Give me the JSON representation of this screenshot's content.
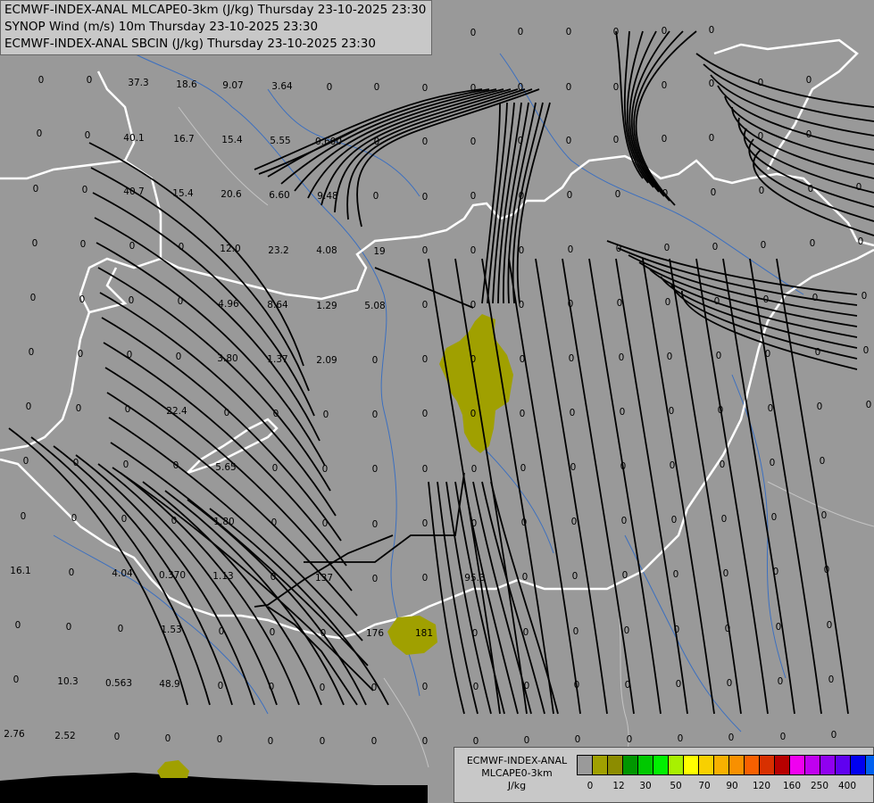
{
  "titles": [
    "ECMWF-INDEX-ANAL MLCAPE0-3km (J/kg) Thursday 23-10-2025 23:30",
    "SYNOP Wind (m/s) 10m Thursday 23-10-2025 23:30",
    "ECMWF-INDEX-ANAL SBCIN (J/kg) Thursday 23-10-2025 23:30"
  ],
  "legend": {
    "title_line1": "ECMWF-INDEX-ANAL",
    "title_line2": "MLCAPE0-3km",
    "unit": "J/kg",
    "colors": [
      "#9a9a9a",
      "#a0a000",
      "#8c8c00",
      "#009600",
      "#00c800",
      "#00f000",
      "#a8f000",
      "#ffff00",
      "#f8d000",
      "#f8b000",
      "#f89000",
      "#f86000",
      "#d83000",
      "#b80000",
      "#f000f0",
      "#c000f0",
      "#9000f0",
      "#6000f0",
      "#0000f0",
      "#0060f0",
      "#00a0f8",
      "#00e0f8",
      "#a0f8f8",
      "#ffffff"
    ],
    "ticks": [
      "0",
      "12",
      "30",
      "50",
      "70",
      "90",
      "120",
      "160",
      "250",
      "400"
    ]
  },
  "values": [
    {
      "t": "0",
      "c": [
        46,
        90
      ]
    },
    {
      "t": "0",
      "c": [
        100,
        90
      ]
    },
    {
      "t": "37.3",
      "c": [
        155,
        93
      ]
    },
    {
      "t": "18.6",
      "c": [
        209,
        95
      ]
    },
    {
      "t": "9.07",
      "c": [
        261,
        96
      ]
    },
    {
      "t": "3.64",
      "c": [
        316,
        97
      ]
    },
    {
      "t": "0",
      "c": [
        369,
        98
      ]
    },
    {
      "t": "0",
      "c": [
        422,
        98
      ]
    },
    {
      "t": "0",
      "c": [
        476,
        99
      ]
    },
    {
      "t": "0",
      "c": [
        530,
        99
      ]
    },
    {
      "t": "0",
      "c": [
        583,
        98
      ]
    },
    {
      "t": "0",
      "c": [
        637,
        98
      ]
    },
    {
      "t": "0",
      "c": [
        690,
        98
      ]
    },
    {
      "t": "0",
      "c": [
        744,
        96
      ]
    },
    {
      "t": "0",
      "c": [
        797,
        94
      ]
    },
    {
      "t": "0",
      "c": [
        852,
        93
      ]
    },
    {
      "t": "0",
      "c": [
        906,
        90
      ]
    },
    {
      "t": "0",
      "c": [
        370,
        37
      ]
    },
    {
      "t": "0",
      "c": [
        422,
        37
      ]
    },
    {
      "t": "0",
      "c": [
        476,
        37
      ]
    },
    {
      "t": "0",
      "c": [
        530,
        37
      ]
    },
    {
      "t": "0",
      "c": [
        583,
        36
      ]
    },
    {
      "t": "0",
      "c": [
        637,
        36
      ]
    },
    {
      "t": "0",
      "c": [
        690,
        36
      ]
    },
    {
      "t": "0",
      "c": [
        744,
        35
      ]
    },
    {
      "t": "0",
      "c": [
        797,
        34
      ]
    },
    {
      "t": "0",
      "c": [
        44,
        150
      ]
    },
    {
      "t": "0",
      "c": [
        98,
        152
      ]
    },
    {
      "t": "40.1",
      "c": [
        150,
        155
      ]
    },
    {
      "t": "16.7",
      "c": [
        206,
        156
      ]
    },
    {
      "t": "15.4",
      "c": [
        260,
        157
      ]
    },
    {
      "t": "5.55",
      "c": [
        314,
        158
      ]
    },
    {
      "t": "0.600",
      "c": [
        368,
        159
      ]
    },
    {
      "t": "0",
      "c": [
        422,
        159
      ]
    },
    {
      "t": "0",
      "c": [
        476,
        159
      ]
    },
    {
      "t": "0",
      "c": [
        530,
        159
      ]
    },
    {
      "t": "0",
      "c": [
        583,
        158
      ]
    },
    {
      "t": "0",
      "c": [
        637,
        158
      ]
    },
    {
      "t": "0",
      "c": [
        690,
        157
      ]
    },
    {
      "t": "0",
      "c": [
        744,
        156
      ]
    },
    {
      "t": "0",
      "c": [
        797,
        155
      ]
    },
    {
      "t": "0",
      "c": [
        852,
        153
      ]
    },
    {
      "t": "0",
      "c": [
        906,
        151
      ]
    },
    {
      "t": "0",
      "c": [
        40,
        212
      ]
    },
    {
      "t": "0",
      "c": [
        95,
        213
      ]
    },
    {
      "t": "40.7",
      "c": [
        150,
        215
      ]
    },
    {
      "t": "15.4",
      "c": [
        205,
        217
      ]
    },
    {
      "t": "20.6",
      "c": [
        259,
        218
      ]
    },
    {
      "t": "6.60",
      "c": [
        313,
        219
      ]
    },
    {
      "t": "9.48",
      "c": [
        367,
        220
      ]
    },
    {
      "t": "0",
      "c": [
        421,
        220
      ]
    },
    {
      "t": "0",
      "c": [
        476,
        221
      ]
    },
    {
      "t": "0",
      "c": [
        530,
        220
      ]
    },
    {
      "t": "0",
      "c": [
        584,
        220
      ]
    },
    {
      "t": "0",
      "c": [
        638,
        219
      ]
    },
    {
      "t": "0",
      "c": [
        692,
        218
      ]
    },
    {
      "t": "0",
      "c": [
        745,
        217
      ]
    },
    {
      "t": "0",
      "c": [
        799,
        216
      ]
    },
    {
      "t": "0",
      "c": [
        853,
        214
      ]
    },
    {
      "t": "0",
      "c": [
        908,
        212
      ]
    },
    {
      "t": "0",
      "c": [
        962,
        210
      ]
    },
    {
      "t": "0",
      "c": [
        39,
        273
      ]
    },
    {
      "t": "0",
      "c": [
        93,
        274
      ]
    },
    {
      "t": "0",
      "c": [
        148,
        276
      ]
    },
    {
      "t": "0",
      "c": [
        203,
        277
      ]
    },
    {
      "t": "12.0",
      "c": [
        258,
        279
      ]
    },
    {
      "t": "23.2",
      "c": [
        312,
        281
      ]
    },
    {
      "t": "4.08",
      "c": [
        366,
        281
      ]
    },
    {
      "t": "19",
      "c": [
        425,
        282
      ]
    },
    {
      "t": "0",
      "c": [
        476,
        281
      ]
    },
    {
      "t": "0",
      "c": [
        530,
        281
      ]
    },
    {
      "t": "0",
      "c": [
        584,
        281
      ]
    },
    {
      "t": "0",
      "c": [
        639,
        280
      ]
    },
    {
      "t": "0",
      "c": [
        693,
        279
      ]
    },
    {
      "t": "0",
      "c": [
        747,
        278
      ]
    },
    {
      "t": "0",
      "c": [
        801,
        277
      ]
    },
    {
      "t": "0",
      "c": [
        855,
        275
      ]
    },
    {
      "t": "0",
      "c": [
        910,
        273
      ]
    },
    {
      "t": "0",
      "c": [
        964,
        271
      ]
    },
    {
      "t": "0",
      "c": [
        37,
        334
      ]
    },
    {
      "t": "0",
      "c": [
        92,
        336
      ]
    },
    {
      "t": "0",
      "c": [
        147,
        337
      ]
    },
    {
      "t": "0",
      "c": [
        202,
        338
      ]
    },
    {
      "t": "4.96",
      "c": [
        256,
        341
      ]
    },
    {
      "t": "8.64",
      "c": [
        311,
        342
      ]
    },
    {
      "t": "1.29",
      "c": [
        366,
        343
      ]
    },
    {
      "t": "5.08",
      "c": [
        420,
        343
      ]
    },
    {
      "t": "0",
      "c": [
        476,
        342
      ]
    },
    {
      "t": "0",
      "c": [
        530,
        342
      ]
    },
    {
      "t": "0",
      "c": [
        584,
        342
      ]
    },
    {
      "t": "0",
      "c": [
        639,
        341
      ]
    },
    {
      "t": "0",
      "c": [
        694,
        340
      ]
    },
    {
      "t": "0",
      "c": [
        748,
        339
      ]
    },
    {
      "t": "0",
      "c": [
        803,
        338
      ]
    },
    {
      "t": "0",
      "c": [
        858,
        336
      ]
    },
    {
      "t": "0",
      "c": [
        913,
        334
      ]
    },
    {
      "t": "0",
      "c": [
        968,
        332
      ]
    },
    {
      "t": "0",
      "c": [
        35,
        395
      ]
    },
    {
      "t": "0",
      "c": [
        90,
        397
      ]
    },
    {
      "t": "0",
      "c": [
        145,
        398
      ]
    },
    {
      "t": "0",
      "c": [
        200,
        400
      ]
    },
    {
      "t": "3.80",
      "c": [
        255,
        402
      ]
    },
    {
      "t": "1.37",
      "c": [
        311,
        403
      ]
    },
    {
      "t": "2.09",
      "c": [
        366,
        404
      ]
    },
    {
      "t": "0",
      "c": [
        420,
        404
      ]
    },
    {
      "t": "0",
      "c": [
        476,
        403
      ]
    },
    {
      "t": "0",
      "c": [
        530,
        403
      ]
    },
    {
      "t": "0",
      "c": [
        585,
        403
      ]
    },
    {
      "t": "0",
      "c": [
        640,
        402
      ]
    },
    {
      "t": "0",
      "c": [
        696,
        401
      ]
    },
    {
      "t": "0",
      "c": [
        750,
        400
      ]
    },
    {
      "t": "0",
      "c": [
        805,
        399
      ]
    },
    {
      "t": "0",
      "c": [
        860,
        397
      ]
    },
    {
      "t": "0",
      "c": [
        916,
        395
      ]
    },
    {
      "t": "0",
      "c": [
        970,
        393
      ]
    },
    {
      "t": "0",
      "c": [
        32,
        456
      ]
    },
    {
      "t": "0",
      "c": [
        88,
        458
      ]
    },
    {
      "t": "0",
      "c": [
        143,
        459
      ]
    },
    {
      "t": "22.4",
      "c": [
        198,
        461
      ]
    },
    {
      "t": "0",
      "c": [
        254,
        463
      ]
    },
    {
      "t": "0",
      "c": [
        309,
        464
      ]
    },
    {
      "t": "0",
      "c": [
        365,
        465
      ]
    },
    {
      "t": "0",
      "c": [
        420,
        465
      ]
    },
    {
      "t": "0",
      "c": [
        476,
        464
      ]
    },
    {
      "t": "0",
      "c": [
        530,
        464
      ]
    },
    {
      "t": "0",
      "c": [
        585,
        464
      ]
    },
    {
      "t": "0",
      "c": [
        641,
        463
      ]
    },
    {
      "t": "0",
      "c": [
        697,
        462
      ]
    },
    {
      "t": "0",
      "c": [
        752,
        461
      ]
    },
    {
      "t": "0",
      "c": [
        807,
        460
      ]
    },
    {
      "t": "0",
      "c": [
        863,
        458
      ]
    },
    {
      "t": "0",
      "c": [
        918,
        456
      ]
    },
    {
      "t": "0",
      "c": [
        973,
        454
      ]
    },
    {
      "t": "0",
      "c": [
        29,
        517
      ]
    },
    {
      "t": "0",
      "c": [
        85,
        519
      ]
    },
    {
      "t": "0",
      "c": [
        141,
        521
      ]
    },
    {
      "t": "0",
      "c": [
        197,
        522
      ]
    },
    {
      "t": "5.65",
      "c": [
        253,
        524
      ]
    },
    {
      "t": "0",
      "c": [
        308,
        525
      ]
    },
    {
      "t": "0",
      "c": [
        364,
        526
      ]
    },
    {
      "t": "0",
      "c": [
        420,
        526
      ]
    },
    {
      "t": "0",
      "c": [
        476,
        526
      ]
    },
    {
      "t": "0",
      "c": [
        531,
        526
      ]
    },
    {
      "t": "0",
      "c": [
        586,
        525
      ]
    },
    {
      "t": "0",
      "c": [
        642,
        524
      ]
    },
    {
      "t": "0",
      "c": [
        698,
        523
      ]
    },
    {
      "t": "0",
      "c": [
        753,
        522
      ]
    },
    {
      "t": "0",
      "c": [
        809,
        521
      ]
    },
    {
      "t": "0",
      "c": [
        865,
        519
      ]
    },
    {
      "t": "0",
      "c": [
        921,
        517
      ]
    },
    {
      "t": "0",
      "c": [
        26,
        579
      ]
    },
    {
      "t": "0",
      "c": [
        83,
        581
      ]
    },
    {
      "t": "0",
      "c": [
        139,
        582
      ]
    },
    {
      "t": "0",
      "c": [
        195,
        584
      ]
    },
    {
      "t": "1.80",
      "c": [
        251,
        585
      ]
    },
    {
      "t": "0",
      "c": [
        307,
        586
      ]
    },
    {
      "t": "0",
      "c": [
        364,
        587
      ]
    },
    {
      "t": "0",
      "c": [
        420,
        588
      ]
    },
    {
      "t": "0",
      "c": [
        476,
        587
      ]
    },
    {
      "t": "0",
      "c": [
        531,
        587
      ]
    },
    {
      "t": "0",
      "c": [
        587,
        586
      ]
    },
    {
      "t": "0",
      "c": [
        643,
        585
      ]
    },
    {
      "t": "0",
      "c": [
        699,
        584
      ]
    },
    {
      "t": "0",
      "c": [
        755,
        583
      ]
    },
    {
      "t": "0",
      "c": [
        811,
        582
      ]
    },
    {
      "t": "0",
      "c": [
        867,
        580
      ]
    },
    {
      "t": "0",
      "c": [
        923,
        578
      ]
    },
    {
      "t": "16.1",
      "c": [
        23,
        640
      ]
    },
    {
      "t": "0",
      "c": [
        80,
        642
      ]
    },
    {
      "t": "4.04",
      "c": [
        137,
        643
      ]
    },
    {
      "t": "0.370",
      "c": [
        193,
        645
      ]
    },
    {
      "t": "1.13",
      "c": [
        250,
        646
      ]
    },
    {
      "t": "0",
      "c": [
        306,
        647
      ]
    },
    {
      "t": "137",
      "c": [
        363,
        648
      ]
    },
    {
      "t": "0",
      "c": [
        420,
        649
      ]
    },
    {
      "t": "0",
      "c": [
        476,
        648
      ]
    },
    {
      "t": "95.3",
      "c": [
        532,
        648
      ]
    },
    {
      "t": "0",
      "c": [
        588,
        647
      ]
    },
    {
      "t": "0",
      "c": [
        644,
        646
      ]
    },
    {
      "t": "0",
      "c": [
        700,
        645
      ]
    },
    {
      "t": "0",
      "c": [
        757,
        644
      ]
    },
    {
      "t": "0",
      "c": [
        813,
        643
      ]
    },
    {
      "t": "0",
      "c": [
        869,
        641
      ]
    },
    {
      "t": "0",
      "c": [
        926,
        639
      ]
    },
    {
      "t": "0",
      "c": [
        20,
        701
      ]
    },
    {
      "t": "0",
      "c": [
        77,
        703
      ]
    },
    {
      "t": "0",
      "c": [
        135,
        705
      ]
    },
    {
      "t": "1.53",
      "c": [
        192,
        706
      ]
    },
    {
      "t": "0",
      "c": [
        248,
        708
      ]
    },
    {
      "t": "0",
      "c": [
        305,
        709
      ]
    },
    {
      "t": "0",
      "c": [
        362,
        710
      ]
    },
    {
      "t": "176",
      "c": [
        420,
        710
      ]
    },
    {
      "t": "181",
      "c": [
        475,
        710
      ]
    },
    {
      "t": "0",
      "c": [
        532,
        710
      ]
    },
    {
      "t": "0",
      "c": [
        589,
        709
      ]
    },
    {
      "t": "0",
      "c": [
        645,
        708
      ]
    },
    {
      "t": "0",
      "c": [
        702,
        707
      ]
    },
    {
      "t": "0",
      "c": [
        758,
        706
      ]
    },
    {
      "t": "0",
      "c": [
        815,
        705
      ]
    },
    {
      "t": "0",
      "c": [
        872,
        703
      ]
    },
    {
      "t": "0",
      "c": [
        929,
        701
      ]
    },
    {
      "t": "0",
      "c": [
        18,
        762
      ]
    },
    {
      "t": "10.3",
      "c": [
        76,
        764
      ]
    },
    {
      "t": "0.563",
      "c": [
        133,
        766
      ]
    },
    {
      "t": "48.9",
      "c": [
        190,
        767
      ]
    },
    {
      "t": "0",
      "c": [
        247,
        769
      ]
    },
    {
      "t": "0",
      "c": [
        304,
        770
      ]
    },
    {
      "t": "0",
      "c": [
        361,
        771
      ]
    },
    {
      "t": "0",
      "c": [
        419,
        771
      ]
    },
    {
      "t": "0",
      "c": [
        476,
        770
      ]
    },
    {
      "t": "0",
      "c": [
        533,
        770
      ]
    },
    {
      "t": "0",
      "c": [
        590,
        769
      ]
    },
    {
      "t": "0",
      "c": [
        646,
        768
      ]
    },
    {
      "t": "0",
      "c": [
        703,
        768
      ]
    },
    {
      "t": "0",
      "c": [
        760,
        767
      ]
    },
    {
      "t": "0",
      "c": [
        817,
        766
      ]
    },
    {
      "t": "0",
      "c": [
        874,
        764
      ]
    },
    {
      "t": "0",
      "c": [
        931,
        762
      ]
    },
    {
      "t": "2.76",
      "c": [
        16,
        823
      ]
    },
    {
      "t": "2.52",
      "c": [
        73,
        825
      ]
    },
    {
      "t": "0",
      "c": [
        131,
        826
      ]
    },
    {
      "t": "0",
      "c": [
        188,
        828
      ]
    },
    {
      "t": "0",
      "c": [
        246,
        829
      ]
    },
    {
      "t": "0",
      "c": [
        303,
        831
      ]
    },
    {
      "t": "0",
      "c": [
        361,
        831
      ]
    },
    {
      "t": "0",
      "c": [
        419,
        831
      ]
    },
    {
      "t": "0",
      "c": [
        476,
        831
      ]
    },
    {
      "t": "0",
      "c": [
        533,
        831
      ]
    },
    {
      "t": "0",
      "c": [
        590,
        830
      ]
    },
    {
      "t": "0",
      "c": [
        647,
        829
      ]
    },
    {
      "t": "0",
      "c": [
        705,
        829
      ]
    },
    {
      "t": "0",
      "c": [
        762,
        828
      ]
    },
    {
      "t": "0",
      "c": [
        819,
        827
      ]
    },
    {
      "t": "0",
      "c": [
        877,
        826
      ]
    },
    {
      "t": "0",
      "c": [
        934,
        824
      ]
    }
  ]
}
